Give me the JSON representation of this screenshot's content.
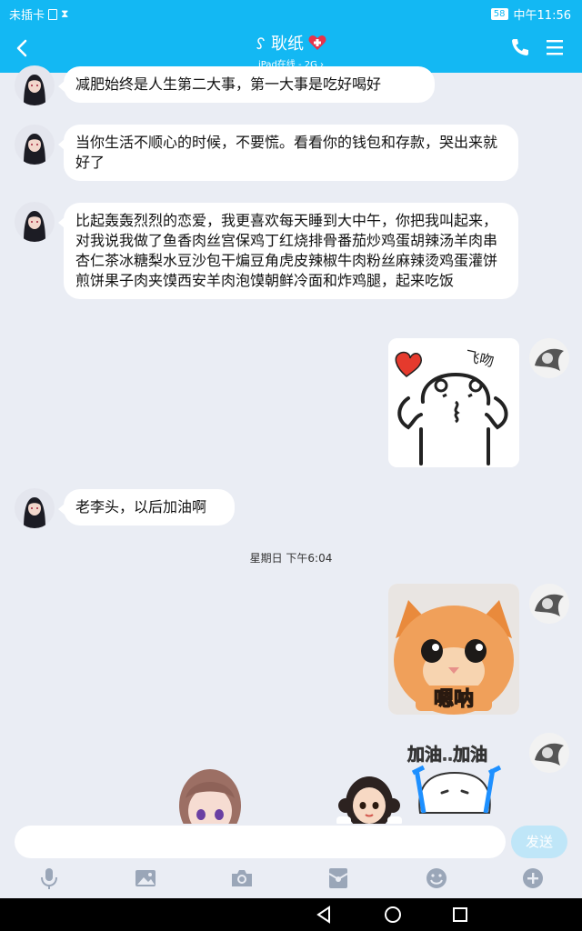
{
  "status_bar": {
    "carrier": "未插卡",
    "battery": "58",
    "time": "中午11:56"
  },
  "header": {
    "contact_name": "耿纸",
    "subtitle": "iPad在线 - 2G ›",
    "icons": [
      "back-arrow-icon",
      "ear-icon",
      "heart-badge-icon",
      "phone-icon",
      "menu-icon"
    ]
  },
  "messages": [
    {
      "side": "left",
      "text": "减肥始终是人生第二大事，第一大事是吃好喝好"
    },
    {
      "side": "left",
      "text": "当你生活不顺心的时候，不要慌。看看你的钱包和存款，哭出来就好了"
    },
    {
      "side": "left",
      "text": "比起轰轰烈烈的恋爱，我更喜欢每天睡到大中午，你把我叫起来，对我说我做了鱼香肉丝宫保鸡丁红烧排骨番茄炒鸡蛋胡辣汤羊肉串杏仁茶冰糖梨水豆沙包干煸豆角虎皮辣椒牛肉粉丝麻辣烫鸡蛋灌饼煎饼果子肉夹馍西安羊肉泡馍朝鲜冷面和炸鸡腿，起来吃饭"
    },
    {
      "side": "right",
      "sticker": "飞吻"
    },
    {
      "side": "left",
      "text": "老李头，以后加油啊"
    },
    {
      "side": "right",
      "sticker": "嗯呐"
    },
    {
      "side": "right",
      "sticker": "加油..加油"
    }
  ],
  "timestamp": "星期日 下午6:04",
  "input": {
    "value": "",
    "placeholder": "",
    "send_label": "发送"
  },
  "toolbar_icons": [
    "microphone-icon",
    "image-icon",
    "camera-icon",
    "red-packet-icon",
    "emoji-icon",
    "plus-icon"
  ],
  "nav_icons": [
    "back-triangle-icon",
    "home-circle-icon",
    "recents-square-icon"
  ],
  "colors": {
    "accent": "#13b8f3",
    "background": "#eaedf4",
    "bubble": "#ffffff",
    "send_disabled": "#bfe6f8"
  }
}
